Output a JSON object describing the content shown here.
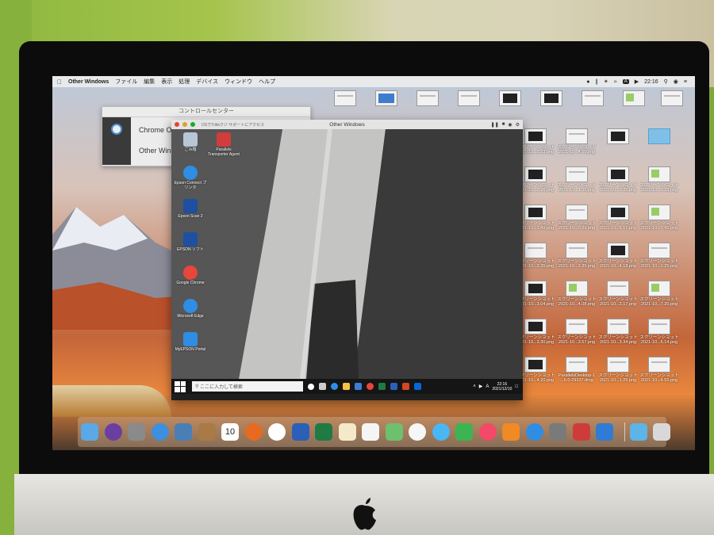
{
  "menubar": {
    "app_name": "Other Windows",
    "items": [
      "ファイル",
      "編集",
      "表示",
      "処理",
      "デバイス",
      "ウィンドウ",
      "ヘルプ"
    ],
    "input_badge": "A",
    "clock": "22:16"
  },
  "control_center": {
    "title": "コントロールセンター",
    "items": [
      "Chrome OS",
      "Other Windows"
    ]
  },
  "vm_window": {
    "subtitle": "OSでTrikkクジ サポートにアクセス",
    "title": "Other Windows"
  },
  "windows_desktop": {
    "icons": [
      {
        "label": "ごみ箱",
        "icon": "recycle-bin-icon"
      },
      {
        "label": "Parallels Transporter Agent",
        "icon": "parallels-transporter-icon"
      },
      {
        "label": "Epson Connect プリンタ",
        "icon": "edge-icon"
      },
      {
        "label": "Epson Scan 2",
        "icon": "epson-scan-icon"
      },
      {
        "label": "EPSON ソフト",
        "icon": "epson-software-icon"
      },
      {
        "label": "Google Chrome",
        "icon": "chrome-icon"
      },
      {
        "label": "Microsoft Edge",
        "icon": "edge-icon"
      },
      {
        "label": "MyEPSON Portal",
        "icon": "myepson-icon"
      }
    ],
    "taskbar": {
      "search_placeholder": "ここに入力して検索",
      "tray_lang": "A",
      "time": "22:16",
      "date": "2021/12/10"
    }
  },
  "mac_desktop_icons": [
    {
      "label": "",
      "kind": "light"
    },
    {
      "label": "",
      "kind": "blue"
    },
    {
      "label": "",
      "kind": "light"
    },
    {
      "label": "",
      "kind": "light"
    },
    {
      "label": "",
      "kind": "dark"
    },
    {
      "label": "",
      "kind": "dark"
    },
    {
      "label": "",
      "kind": "light"
    },
    {
      "label": "",
      "kind": "color"
    },
    {
      "label": "",
      "kind": "light"
    },
    {
      "label": "スクリーンショット 2021-10...0.23.png",
      "kind": "dark"
    },
    {
      "label": "スクリーンショット 2021-10...4.50.png",
      "kind": "light"
    },
    {
      "label": "",
      "kind": "dark"
    },
    {
      "label": "",
      "kind": "folder"
    },
    {
      "label": "スクリーンショット 2021-10...0.26.png",
      "kind": "dark"
    },
    {
      "label": "スクリーンショット 2021-10...1.11.png",
      "kind": "light"
    },
    {
      "label": "スクリーンショット 2021-10...0.35.png",
      "kind": "dark"
    },
    {
      "label": "スクリーンショット 2021-10...0.23.png",
      "kind": "color"
    },
    {
      "label": "スクリーンショット 2021-10...1.49.png",
      "kind": "dark"
    },
    {
      "label": "スクリーンショット 2021-10...0.29.png",
      "kind": "light"
    },
    {
      "label": "スクリーンショット 2021-10...6.17.png",
      "kind": "dark"
    },
    {
      "label": "スクリーンショット 2021-10...7.41.png",
      "kind": "color"
    },
    {
      "label": "スクリーンショット 2021-10...2.35.png",
      "kind": "light"
    },
    {
      "label": "スクリーンショット 2021-10...3.35.png",
      "kind": "light"
    },
    {
      "label": "スクリーンショット 2021-10...4.18.png",
      "kind": "dark"
    },
    {
      "label": "スクリーンショット 2021-10...1.25.png",
      "kind": "light"
    },
    {
      "label": "スクリーンショット 2021-10...3.04.png",
      "kind": "dark"
    },
    {
      "label": "スクリーンショット 2021-10...4.08.png",
      "kind": "color"
    },
    {
      "label": "スクリーンショット 2021-10...2.17.png",
      "kind": "light"
    },
    {
      "label": "スクリーンショット 2021-10...7.20.png",
      "kind": "color"
    },
    {
      "label": "スクリーンショット 2021-10...3.30.png",
      "kind": "dark"
    },
    {
      "label": "スクリーンショット 2021-10...3.57.png",
      "kind": "light"
    },
    {
      "label": "スクリーンショット 2021-10...3.34.png",
      "kind": "light"
    },
    {
      "label": "スクリーンショット 2021-10...6.14.png",
      "kind": "light"
    },
    {
      "label": "スクリーンショット 2021-10...4.20.png",
      "kind": "dark"
    },
    {
      "label": "ParallelsDesktop-1 ...6.0-29337.dmg",
      "kind": "light"
    },
    {
      "label": "スクリーンショット 2021-10...1.26.png",
      "kind": "light"
    },
    {
      "label": "スクリーンショット 2021-10...4.55.png",
      "kind": "light"
    }
  ],
  "dock": {
    "calendar_day": "10",
    "apps": [
      {
        "name": "finder-icon",
        "color": "#5aa9e6"
      },
      {
        "name": "siri-icon",
        "color": "#6b3fa0"
      },
      {
        "name": "launchpad-icon",
        "color": "#8a8a8a"
      },
      {
        "name": "safari-icon",
        "color": "#3d8fe0"
      },
      {
        "name": "preview-icon",
        "color": "#4a7fb5"
      },
      {
        "name": "notes-brown-icon",
        "color": "#a97a45"
      },
      {
        "name": "calendar-icon",
        "color": "#ffffff"
      },
      {
        "name": "firefox-icon",
        "color": "#e66a22"
      },
      {
        "name": "chrome-icon",
        "color": "#ffffff"
      },
      {
        "name": "word-icon",
        "color": "#2b5fb8"
      },
      {
        "name": "excel-icon",
        "color": "#1f7a44"
      },
      {
        "name": "stickies-icon",
        "color": "#f4e9c8"
      },
      {
        "name": "reminders-icon",
        "color": "#f5f5f5"
      },
      {
        "name": "maps-icon",
        "color": "#6cc06e"
      },
      {
        "name": "photos-icon",
        "color": "#f6f6f6"
      },
      {
        "name": "messages-icon",
        "color": "#49b6f5"
      },
      {
        "name": "facetime-icon",
        "color": "#3cb451"
      },
      {
        "name": "music-icon",
        "color": "#f44968"
      },
      {
        "name": "books-icon",
        "color": "#f08a24"
      },
      {
        "name": "app-store-icon",
        "color": "#2f8de4"
      },
      {
        "name": "system-preferences-icon",
        "color": "#7a7a7a"
      },
      {
        "name": "parallels-icon",
        "color": "#cf3b3b"
      },
      {
        "name": "windows-apps-icon",
        "color": "#2f7bd6"
      }
    ],
    "trailing": [
      {
        "name": "downloads-folder-icon",
        "color": "#5cb5e6"
      },
      {
        "name": "trash-icon",
        "color": "#d8d8d8"
      }
    ]
  }
}
